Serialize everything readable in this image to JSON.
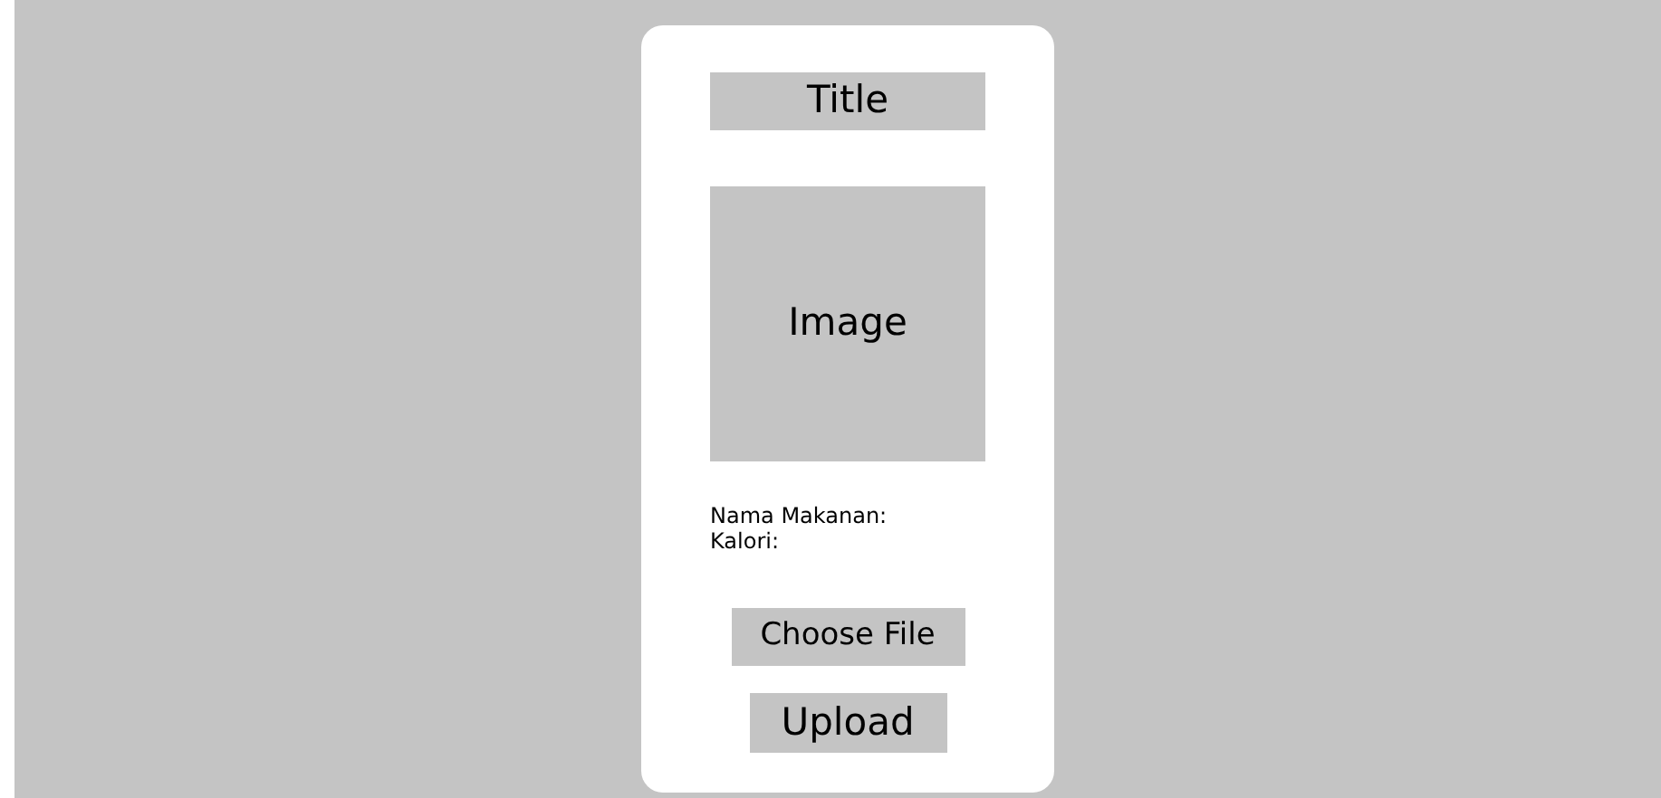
{
  "title": "Title",
  "image": {
    "label": "Image"
  },
  "fields": [
    {
      "label": "Nama Makanan:"
    },
    {
      "label": "Kalori:"
    }
  ],
  "buttons": [
    {
      "label": "Choose File",
      "kind": "file"
    },
    {
      "label": "Upload",
      "kind": "submit"
    }
  ]
}
